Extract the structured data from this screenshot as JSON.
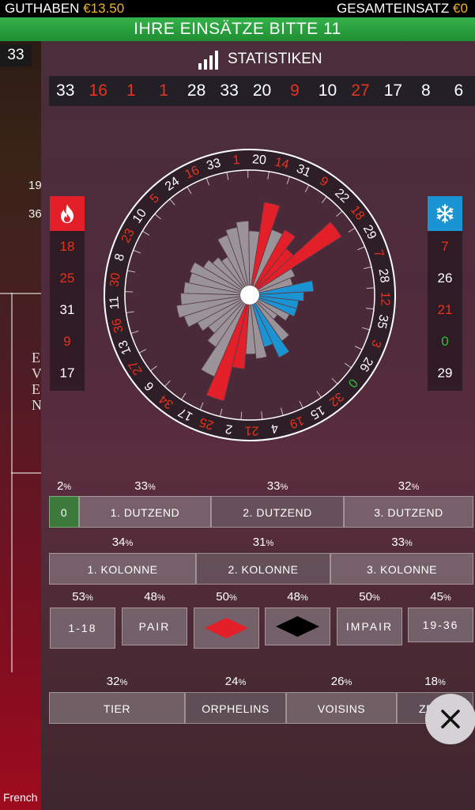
{
  "topbar": {
    "balance_label": "GUTHABEN",
    "balance_value": "€13.50",
    "total_bet_label": "GESAMTEINSATZ",
    "total_bet_value": "€0"
  },
  "betbar": {
    "text": "IHRE EINSÄTZE BITTE 11"
  },
  "background": {
    "round_badge": "33",
    "partial_text_1": "19",
    "partial_text_2": "36",
    "side_letters": [
      "E",
      "V",
      "E",
      "N"
    ],
    "footer_text": "French"
  },
  "panel": {
    "title": "STATISTIKEN",
    "recent_numbers": [
      {
        "n": "33",
        "c": "black"
      },
      {
        "n": "16",
        "c": "red"
      },
      {
        "n": "1",
        "c": "red"
      },
      {
        "n": "1",
        "c": "red"
      },
      {
        "n": "28",
        "c": "black"
      },
      {
        "n": "33",
        "c": "black"
      },
      {
        "n": "20",
        "c": "black"
      },
      {
        "n": "9",
        "c": "red"
      },
      {
        "n": "10",
        "c": "black"
      },
      {
        "n": "27",
        "c": "red"
      },
      {
        "n": "17",
        "c": "black"
      },
      {
        "n": "8",
        "c": "black"
      },
      {
        "n": "6",
        "c": "black"
      }
    ],
    "hot_numbers": [
      {
        "n": "18",
        "c": "red"
      },
      {
        "n": "25",
        "c": "red"
      },
      {
        "n": "31",
        "c": "black"
      },
      {
        "n": "9",
        "c": "red"
      },
      {
        "n": "17",
        "c": "black"
      }
    ],
    "cold_numbers": [
      {
        "n": "7",
        "c": "red"
      },
      {
        "n": "26",
        "c": "black"
      },
      {
        "n": "21",
        "c": "red"
      },
      {
        "n": "0",
        "c": "green"
      },
      {
        "n": "29",
        "c": "black"
      }
    ],
    "wheel": {
      "order": [
        0,
        32,
        15,
        19,
        4,
        21,
        2,
        25,
        17,
        34,
        6,
        27,
        13,
        36,
        11,
        30,
        8,
        23,
        10,
        5,
        24,
        16,
        33,
        1,
        20,
        14,
        31,
        9,
        22,
        18,
        29,
        7,
        28,
        12,
        35,
        3,
        26
      ],
      "red_numbers": [
        1,
        3,
        5,
        7,
        9,
        12,
        14,
        16,
        18,
        19,
        21,
        23,
        25,
        27,
        30,
        32,
        34,
        36
      ],
      "hot_highlight": [
        14,
        9,
        22,
        18,
        2,
        25
      ],
      "cold_highlight": [
        28,
        12,
        35,
        3,
        15,
        19
      ],
      "frequency": {
        "0": 0.2,
        "32": 0.42,
        "15": 0.55,
        "19": 0.4,
        "4": 0.5,
        "21": 0.45,
        "2": 0.6,
        "25": 0.95,
        "17": 0.75,
        "34": 0.48,
        "6": 0.38,
        "27": 0.45,
        "13": 0.55,
        "36": 0.6,
        "11": 0.55,
        "30": 0.52,
        "8": 0.48,
        "23": 0.5,
        "10": 0.4,
        "5": 0.35,
        "24": 0.3,
        "16": 0.5,
        "33": 0.55,
        "1": 0.6,
        "20": 0.5,
        "14": 0.8,
        "31": 0.55,
        "9": 0.6,
        "22": 0.45,
        "18": 0.95,
        "29": 0.35,
        "7": 0.3,
        "28": 0.5,
        "12": 0.4,
        "35": 0.35,
        "3": 0.35,
        "26": 0.3
      }
    },
    "dozens": {
      "zero_pct": "2",
      "zero_label": "0",
      "items": [
        {
          "pct": "33",
          "label": "1. DUTZEND"
        },
        {
          "pct": "33",
          "label": "2. DUTZEND"
        },
        {
          "pct": "32",
          "label": "3. DUTZEND"
        }
      ]
    },
    "columns": [
      {
        "pct": "34",
        "label": "1. KOLONNE"
      },
      {
        "pct": "31",
        "label": "2. KOLONNE"
      },
      {
        "pct": "33",
        "label": "3. KOLONNE"
      }
    ],
    "even_bets": [
      {
        "pct": "53",
        "label": "1-18"
      },
      {
        "pct": "48",
        "label": "PAIR"
      },
      {
        "pct": "50",
        "label": ""
      },
      {
        "pct": "48",
        "label": ""
      },
      {
        "pct": "50",
        "label": "IMPAIR"
      },
      {
        "pct": "45",
        "label": "19-36"
      }
    ],
    "sectors": [
      {
        "pct": "32",
        "label": "TIER"
      },
      {
        "pct": "24",
        "label": "ORPHELINS"
      },
      {
        "pct": "26",
        "label": "VOISINS"
      },
      {
        "pct": "18",
        "label": "ZERO"
      }
    ],
    "percent_sign": "%",
    "colors": {
      "red": "#e8331c",
      "hot": "#e3202a",
      "cold": "#1b94d4",
      "green_zero": "#3c7a3c",
      "bar_grey": "#9a9499"
    }
  }
}
